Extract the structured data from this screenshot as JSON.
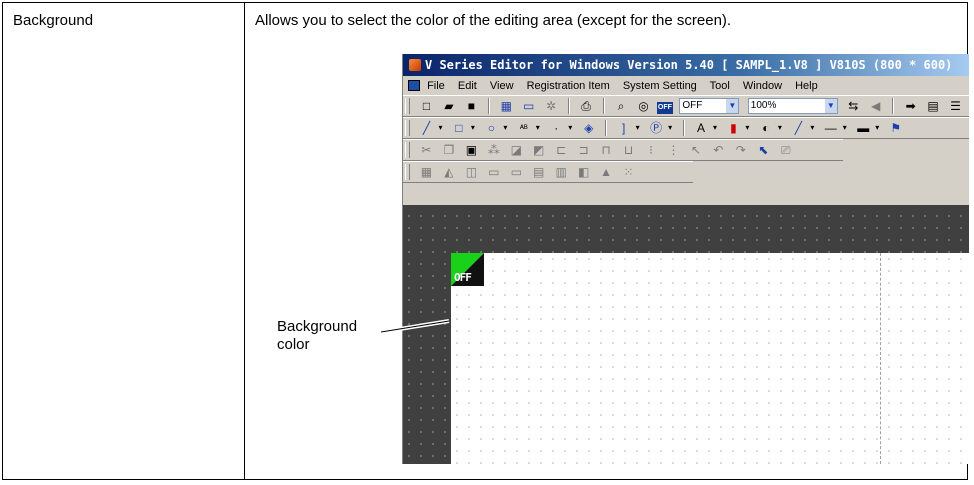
{
  "table": {
    "term": "Background",
    "description": "Allows you to select the color of the editing area (except for the screen)."
  },
  "app": {
    "title": "V Series Editor for Windows Version 5.40 [ SAMPL_1.V8 ] V810S (800 * 600)",
    "menu": [
      "File",
      "Edit",
      "View",
      "Registration Item",
      "System Setting",
      "Tool",
      "Window",
      "Help"
    ],
    "toolbar": {
      "off_label": "OFF",
      "zoom_value": "100%"
    },
    "screen_part_label": "OFF"
  },
  "callout": {
    "line1": "Background",
    "line2": "color"
  },
  "colors": {
    "editing_area": "#404040",
    "screen": "#ffffff",
    "switch_on": "#1ad11a"
  }
}
